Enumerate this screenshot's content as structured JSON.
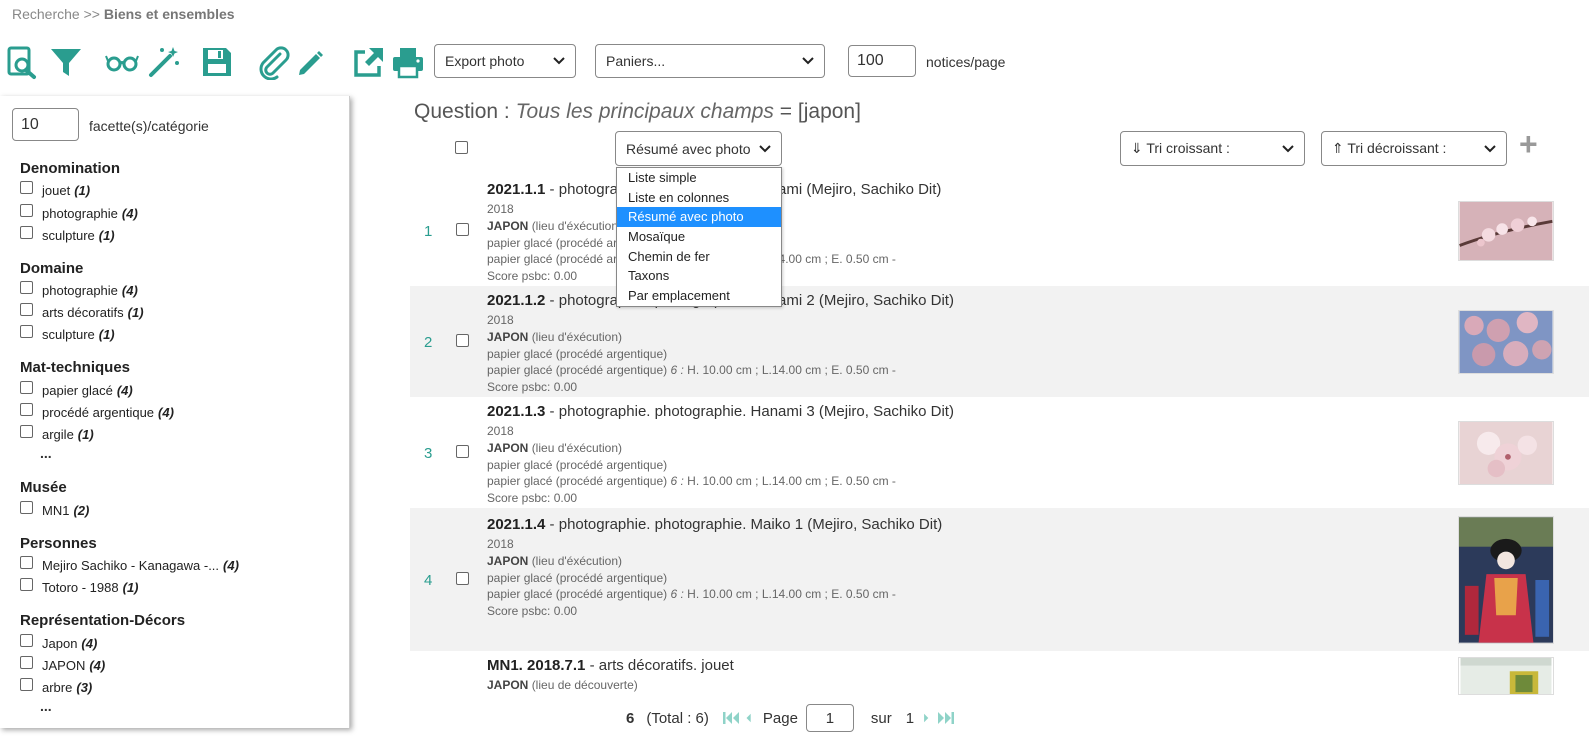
{
  "breadcrumb": {
    "root": "Recherche",
    "separator": ">>",
    "current": "Biens et ensembles"
  },
  "toolbar": {
    "icons": [
      "search-record-icon",
      "filter-icon",
      "glasses-icon",
      "magic-wand-icon",
      "save-icon",
      "attachment-icon",
      "pencil-icon",
      "export-icon",
      "print-icon"
    ],
    "export_select": "Export photo",
    "baskets_select": "Paniers...",
    "per_page_value": "100",
    "per_page_label": "notices/page",
    "accent_color": "#2a9d8f"
  },
  "sidebar": {
    "facets_value": "10",
    "facets_label": "facette(s)/catégorie",
    "categories": [
      {
        "title": "Denomination",
        "items": [
          {
            "label": "jouet",
            "count": "(1)"
          },
          {
            "label": "photographie",
            "count": "(4)"
          },
          {
            "label": "sculpture",
            "count": "(1)"
          }
        ]
      },
      {
        "title": "Domaine",
        "items": [
          {
            "label": "photographie",
            "count": "(4)"
          },
          {
            "label": "arts décoratifs",
            "count": "(1)"
          },
          {
            "label": "sculpture",
            "count": "(1)"
          }
        ]
      },
      {
        "title": "Mat-techniques",
        "items": [
          {
            "label": "papier glacé",
            "count": "(4)"
          },
          {
            "label": "procédé argentique",
            "count": "(4)"
          },
          {
            "label": "argile",
            "count": "(1)"
          }
        ],
        "more": "..."
      },
      {
        "title": "Musée",
        "items": [
          {
            "label": "MN1",
            "count": "(2)"
          }
        ]
      },
      {
        "title": "Personnes",
        "items": [
          {
            "label": "Mejiro Sachiko - Kanagawa -...",
            "count": "(4)"
          },
          {
            "label": "Totoro - 1988",
            "count": "(1)"
          }
        ]
      },
      {
        "title": "Représentation-Décors",
        "items": [
          {
            "label": "Japon",
            "count": "(4)"
          },
          {
            "label": "JAPON",
            "count": "(4)"
          },
          {
            "label": "arbre",
            "count": "(3)"
          }
        ],
        "more": "..."
      }
    ]
  },
  "question": {
    "prefix": "Question :",
    "field": "Tous les principaux champs",
    "op": "=",
    "term": "[japon]"
  },
  "view_select": {
    "value": "Résumé avec photo",
    "options": [
      "Liste simple",
      "Liste en colonnes",
      "Résumé avec photo",
      "Mosaïque",
      "Chemin de fer",
      "Taxons",
      "Par emplacement"
    ]
  },
  "sort": {
    "asc": "⇓ Tri croissant :",
    "desc": "⇑ Tri décroissant :",
    "add": "+"
  },
  "results": [
    {
      "num": "1",
      "id": "2021.1.1",
      "desc": " - photographie. photographie. Hanami (Mejiro, Sachiko Dit)",
      "year": "2018",
      "place": "JAPON",
      "place_role": "(lieu d'éxécution)",
      "mat": "papier glacé (procédé argentique)",
      "dims_mat": "papier glacé (procédé argentique)",
      "dims_n": "6 :",
      "dims": "H. 10.00 cm ; L.14.00 cm ; E. 0.50 cm -",
      "score": "Score psbc: 0.00"
    },
    {
      "num": "2",
      "id": "2021.1.2",
      "desc": " - photographie. photographie. Hanami 2 (Mejiro, Sachiko Dit)",
      "year": "2018",
      "place": "JAPON",
      "place_role": "(lieu d'éxécution)",
      "mat": "papier glacé (procédé argentique)",
      "dims_mat": "papier glacé (procédé argentique)",
      "dims_n": "6 :",
      "dims": "H. 10.00 cm ; L.14.00 cm ; E. 0.50 cm -",
      "score": "Score psbc: 0.00"
    },
    {
      "num": "3",
      "id": "2021.1.3",
      "desc": " - photographie. photographie. Hanami 3 (Mejiro, Sachiko Dit)",
      "year": "2018",
      "place": "JAPON",
      "place_role": "(lieu d'éxécution)",
      "mat": "papier glacé (procédé argentique)",
      "dims_mat": "papier glacé (procédé argentique)",
      "dims_n": "6 :",
      "dims": "H. 10.00 cm ; L.14.00 cm ; E. 0.50 cm -",
      "score": "Score psbc: 0.00"
    },
    {
      "num": "4",
      "id": "2021.1.4",
      "desc": " - photographie. photographie. Maiko 1 (Mejiro, Sachiko Dit)",
      "year": "2018",
      "place": "JAPON",
      "place_role": "(lieu d'éxécution)",
      "mat": "papier glacé (procédé argentique)",
      "dims_mat": "papier glacé (procédé argentique)",
      "dims_n": "6 :",
      "dims": "H. 10.00 cm ; L.14.00 cm ; E. 0.50 cm -",
      "score": "Score psbc: 0.00"
    },
    {
      "num": "",
      "id": "MN1. 2018.7.1",
      "desc": " - arts décoratifs. jouet",
      "place": "JAPON",
      "place_role": "(lieu de découverte)"
    }
  ],
  "pager": {
    "count": "6",
    "total": "(Total : 6)",
    "page_label": "Page",
    "page_value": "1",
    "of_label": "sur",
    "of_value": "1"
  }
}
